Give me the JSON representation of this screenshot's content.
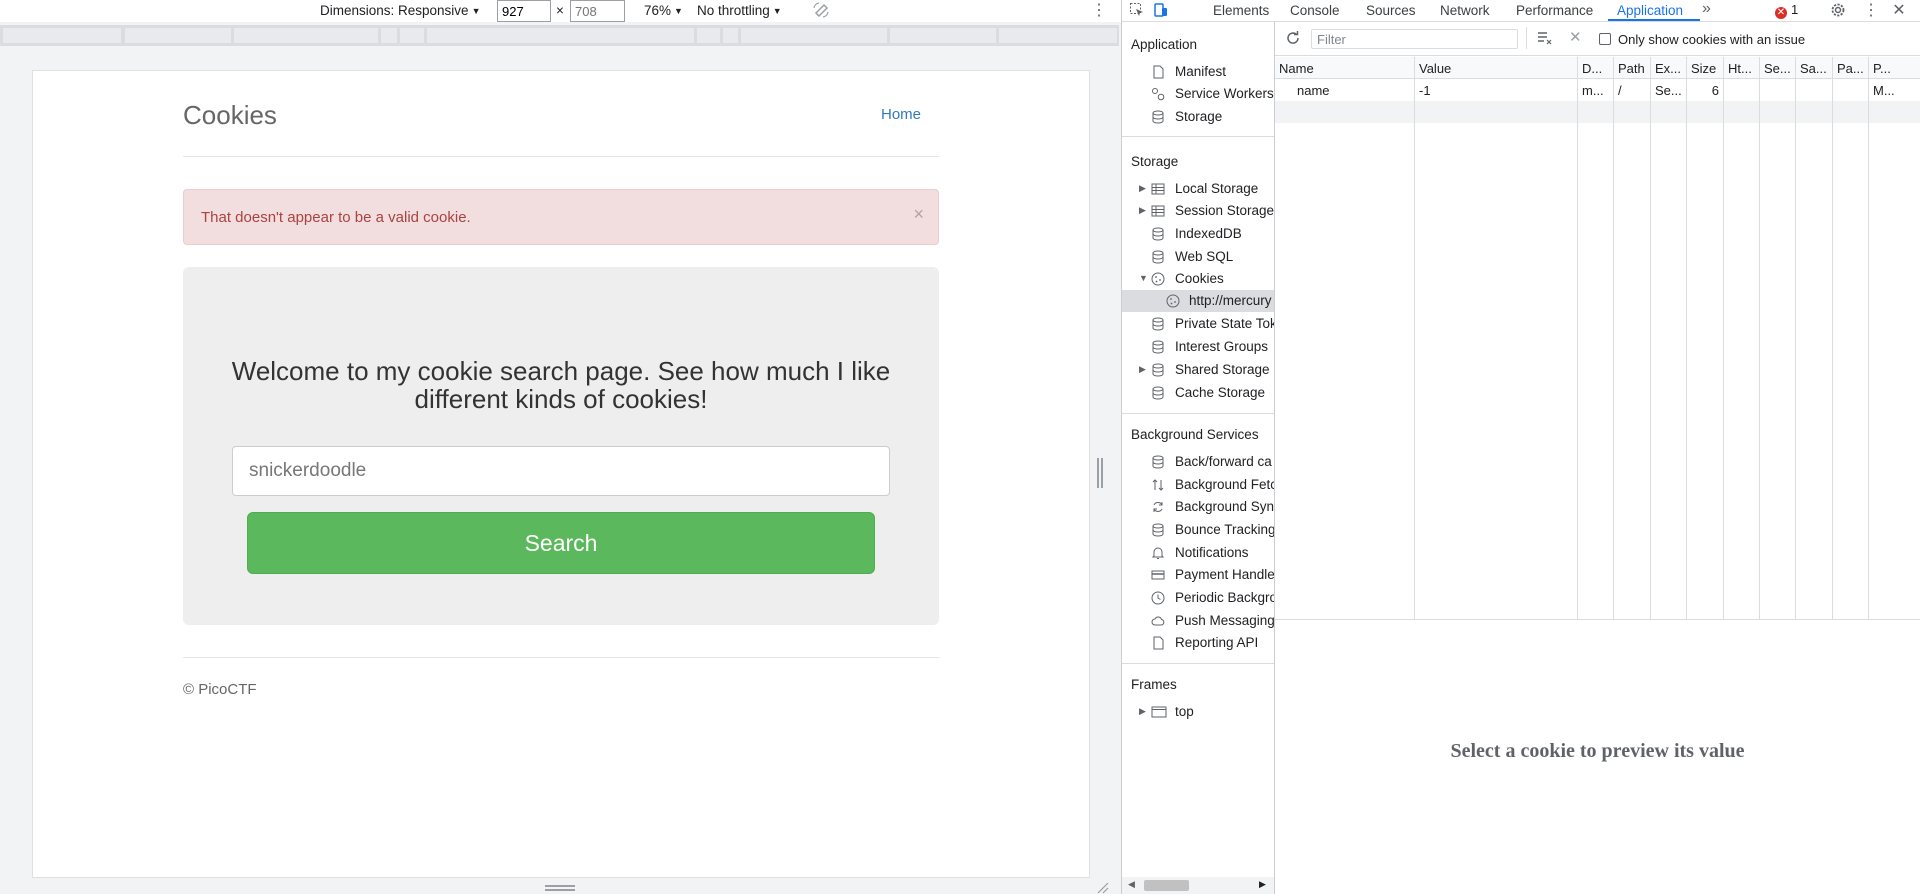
{
  "emulation": {
    "dimensions_label": "Dimensions: Responsive",
    "width": "927",
    "times": "×",
    "height_placeholder": "708",
    "zoom": "76%",
    "throttling": "No throttling"
  },
  "site": {
    "title": "Cookies",
    "nav_home": "Home",
    "alert_text": "That doesn't appear to be a valid cookie.",
    "alert_close": "×",
    "heading": "Welcome to my cookie search page. See how much I like different kinds of cookies!",
    "search_placeholder": "snickerdoodle",
    "search_button": "Search",
    "footer": "© PicoCTF"
  },
  "devtools": {
    "tabs": [
      "Elements",
      "Console",
      "Sources",
      "Network",
      "Performance",
      "Application"
    ],
    "active_tab": "Application",
    "more_tabs": "»",
    "error_count": "1",
    "sidebar": {
      "application_header": "Application",
      "application_items": [
        "Manifest",
        "Service Workers",
        "Storage"
      ],
      "storage_header": "Storage",
      "storage_items": [
        "Local Storage",
        "Session Storage",
        "IndexedDB",
        "Web SQL",
        "Cookies",
        "http://mercury",
        "Private State Tok",
        "Interest Groups",
        "Shared Storage",
        "Cache Storage"
      ],
      "background_header": "Background Services",
      "background_items": [
        "Back/forward ca",
        "Background Fetc",
        "Background Syn",
        "Bounce Tracking",
        "Notifications",
        "Payment Handle",
        "Periodic Backgro",
        "Push Messaging",
        "Reporting API"
      ],
      "frames_header": "Frames",
      "frames_items": [
        "top"
      ]
    },
    "cookies": {
      "filter_placeholder": "Filter",
      "only_issue_label": "Only show cookies with an issue",
      "columns": [
        "Name",
        "Value",
        "D...",
        "Path",
        "Ex...",
        "Size",
        "Ht...",
        "Se...",
        "Sa...",
        "Pa...",
        "P..."
      ],
      "rows": [
        [
          "name",
          "-1",
          "m...",
          "/",
          "Se...",
          "6",
          "",
          "",
          "",
          "",
          "M..."
        ]
      ],
      "preview_text": "Select a cookie to preview its value"
    }
  }
}
